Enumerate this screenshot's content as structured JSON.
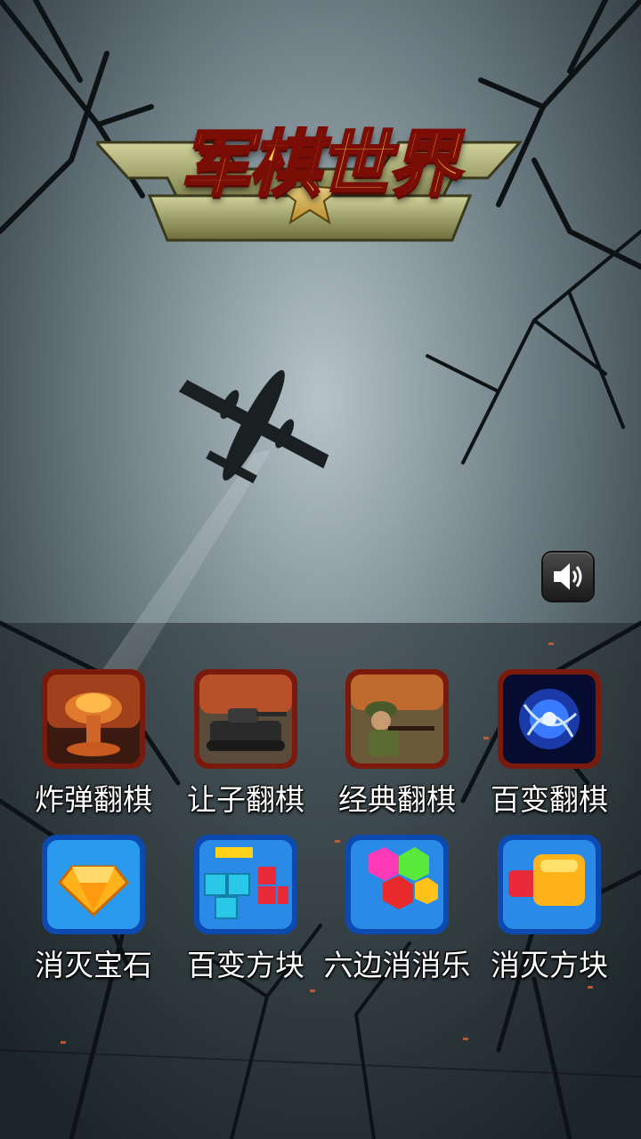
{
  "title": "军棋世界",
  "sound_icon": "speaker-icon",
  "games": [
    {
      "label": "炸弹翻棋",
      "icon": "mushroom-cloud-icon"
    },
    {
      "label": "让子翻棋",
      "icon": "tank-icon"
    },
    {
      "label": "经典翻棋",
      "icon": "soldier-icon"
    },
    {
      "label": "百变翻棋",
      "icon": "energy-sphere-icon"
    },
    {
      "label": "消灭宝石",
      "icon": "gem-icon"
    },
    {
      "label": "百变方块",
      "icon": "blocks-icon"
    },
    {
      "label": "六边消消乐",
      "icon": "hexagon-icon"
    },
    {
      "label": "消灭方块",
      "icon": "cubes-icon"
    }
  ],
  "colors": {
    "logo_gold": "#ffcf3a",
    "logo_red": "#b0180a",
    "frame_red": "#8a1a10",
    "frame_blue": "#1a6fd8"
  }
}
